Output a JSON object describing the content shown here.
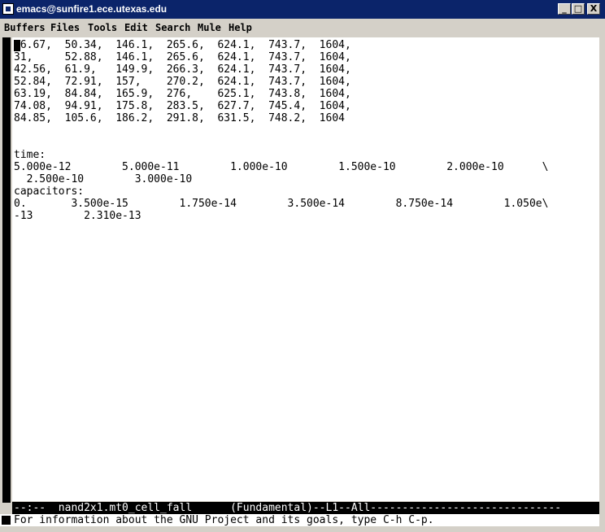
{
  "window": {
    "title": "emacs@sunfire1.ece.utexas.edu",
    "minimize_glyph": "_",
    "maximize_glyph": "□",
    "close_glyph": "X"
  },
  "menu": {
    "items": [
      "Buffers",
      "Files",
      "Tools",
      "Edit",
      "Search",
      "Mule",
      "Help"
    ]
  },
  "buffer": {
    "lines": [
      "26.67,  50.34,  146.1,  265.6,  624.1,  743.7,  1604,",
      "31,     52.88,  146.1,  265.6,  624.1,  743.7,  1604,",
      "42.56,  61.9,   149.9,  266.3,  624.1,  743.7,  1604,",
      "52.84,  72.91,  157,    270.2,  624.1,  743.7,  1604,",
      "63.19,  84.84,  165.9,  276,    625.1,  743.8,  1604,",
      "74.08,  94.91,  175.8,  283.5,  627.7,  745.4,  1604,",
      "84.85,  105.6,  186.2,  291.8,  631.5,  748.2,  1604",
      "",
      "",
      "time:",
      "5.000e-12        5.000e-11        1.000e-10        1.500e-10        2.000e-10      \\",
      "  2.500e-10        3.000e-10",
      "capacitors:",
      "0.       3.500e-15        1.750e-14        3.500e-14        8.750e-14        1.050e\\",
      "-13        2.310e-13"
    ]
  },
  "modeline": {
    "text": "--:--  nand2x1.mt0_cell_fall      (Fundamental)--L1--All------------------------------"
  },
  "minibuffer": {
    "message": "For information about the GNU Project and its goals, type C-h C-p."
  }
}
